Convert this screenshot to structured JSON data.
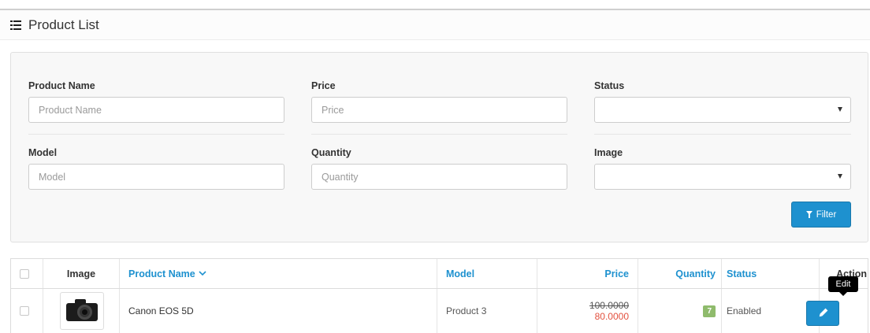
{
  "panel": {
    "title": "Product List",
    "icon": "list-icon"
  },
  "filter": {
    "product_name": {
      "label": "Product Name",
      "placeholder": "Product Name"
    },
    "price": {
      "label": "Price",
      "placeholder": "Price"
    },
    "status": {
      "label": "Status",
      "value": ""
    },
    "model": {
      "label": "Model",
      "placeholder": "Model"
    },
    "quantity": {
      "label": "Quantity",
      "placeholder": "Quantity"
    },
    "image": {
      "label": "Image",
      "value": ""
    },
    "button_label": "Filter"
  },
  "table": {
    "columns": [
      "Image",
      "Product Name",
      "Model",
      "Price",
      "Quantity",
      "Status",
      "Action"
    ],
    "sorted_column": "Product Name",
    "rows": [
      {
        "name": "Canon EOS 5D",
        "model": "Product 3",
        "price_old": "100.0000",
        "price_special": "80.0000",
        "quantity": "7",
        "status": "Enabled",
        "action_tooltip": "Edit"
      }
    ]
  },
  "colors": {
    "primary": "#1e91cf",
    "special_price": "#e3503e",
    "quantity_badge": "#8fbb6c"
  }
}
